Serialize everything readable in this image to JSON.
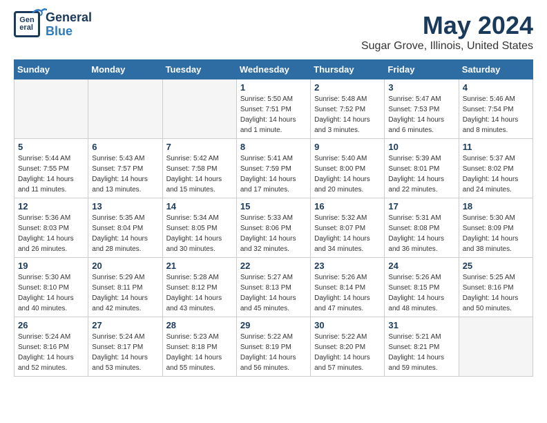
{
  "header": {
    "logo_line1": "General",
    "logo_line2": "Blue",
    "title": "May 2024",
    "subtitle": "Sugar Grove, Illinois, United States"
  },
  "days_of_week": [
    "Sunday",
    "Monday",
    "Tuesday",
    "Wednesday",
    "Thursday",
    "Friday",
    "Saturday"
  ],
  "weeks": [
    [
      {
        "day": "",
        "info": ""
      },
      {
        "day": "",
        "info": ""
      },
      {
        "day": "",
        "info": ""
      },
      {
        "day": "1",
        "info": "Sunrise: 5:50 AM\nSunset: 7:51 PM\nDaylight: 14 hours\nand 1 minute."
      },
      {
        "day": "2",
        "info": "Sunrise: 5:48 AM\nSunset: 7:52 PM\nDaylight: 14 hours\nand 3 minutes."
      },
      {
        "day": "3",
        "info": "Sunrise: 5:47 AM\nSunset: 7:53 PM\nDaylight: 14 hours\nand 6 minutes."
      },
      {
        "day": "4",
        "info": "Sunrise: 5:46 AM\nSunset: 7:54 PM\nDaylight: 14 hours\nand 8 minutes."
      }
    ],
    [
      {
        "day": "5",
        "info": "Sunrise: 5:44 AM\nSunset: 7:55 PM\nDaylight: 14 hours\nand 11 minutes."
      },
      {
        "day": "6",
        "info": "Sunrise: 5:43 AM\nSunset: 7:57 PM\nDaylight: 14 hours\nand 13 minutes."
      },
      {
        "day": "7",
        "info": "Sunrise: 5:42 AM\nSunset: 7:58 PM\nDaylight: 14 hours\nand 15 minutes."
      },
      {
        "day": "8",
        "info": "Sunrise: 5:41 AM\nSunset: 7:59 PM\nDaylight: 14 hours\nand 17 minutes."
      },
      {
        "day": "9",
        "info": "Sunrise: 5:40 AM\nSunset: 8:00 PM\nDaylight: 14 hours\nand 20 minutes."
      },
      {
        "day": "10",
        "info": "Sunrise: 5:39 AM\nSunset: 8:01 PM\nDaylight: 14 hours\nand 22 minutes."
      },
      {
        "day": "11",
        "info": "Sunrise: 5:37 AM\nSunset: 8:02 PM\nDaylight: 14 hours\nand 24 minutes."
      }
    ],
    [
      {
        "day": "12",
        "info": "Sunrise: 5:36 AM\nSunset: 8:03 PM\nDaylight: 14 hours\nand 26 minutes."
      },
      {
        "day": "13",
        "info": "Sunrise: 5:35 AM\nSunset: 8:04 PM\nDaylight: 14 hours\nand 28 minutes."
      },
      {
        "day": "14",
        "info": "Sunrise: 5:34 AM\nSunset: 8:05 PM\nDaylight: 14 hours\nand 30 minutes."
      },
      {
        "day": "15",
        "info": "Sunrise: 5:33 AM\nSunset: 8:06 PM\nDaylight: 14 hours\nand 32 minutes."
      },
      {
        "day": "16",
        "info": "Sunrise: 5:32 AM\nSunset: 8:07 PM\nDaylight: 14 hours\nand 34 minutes."
      },
      {
        "day": "17",
        "info": "Sunrise: 5:31 AM\nSunset: 8:08 PM\nDaylight: 14 hours\nand 36 minutes."
      },
      {
        "day": "18",
        "info": "Sunrise: 5:30 AM\nSunset: 8:09 PM\nDaylight: 14 hours\nand 38 minutes."
      }
    ],
    [
      {
        "day": "19",
        "info": "Sunrise: 5:30 AM\nSunset: 8:10 PM\nDaylight: 14 hours\nand 40 minutes."
      },
      {
        "day": "20",
        "info": "Sunrise: 5:29 AM\nSunset: 8:11 PM\nDaylight: 14 hours\nand 42 minutes."
      },
      {
        "day": "21",
        "info": "Sunrise: 5:28 AM\nSunset: 8:12 PM\nDaylight: 14 hours\nand 43 minutes."
      },
      {
        "day": "22",
        "info": "Sunrise: 5:27 AM\nSunset: 8:13 PM\nDaylight: 14 hours\nand 45 minutes."
      },
      {
        "day": "23",
        "info": "Sunrise: 5:26 AM\nSunset: 8:14 PM\nDaylight: 14 hours\nand 47 minutes."
      },
      {
        "day": "24",
        "info": "Sunrise: 5:26 AM\nSunset: 8:15 PM\nDaylight: 14 hours\nand 48 minutes."
      },
      {
        "day": "25",
        "info": "Sunrise: 5:25 AM\nSunset: 8:16 PM\nDaylight: 14 hours\nand 50 minutes."
      }
    ],
    [
      {
        "day": "26",
        "info": "Sunrise: 5:24 AM\nSunset: 8:16 PM\nDaylight: 14 hours\nand 52 minutes."
      },
      {
        "day": "27",
        "info": "Sunrise: 5:24 AM\nSunset: 8:17 PM\nDaylight: 14 hours\nand 53 minutes."
      },
      {
        "day": "28",
        "info": "Sunrise: 5:23 AM\nSunset: 8:18 PM\nDaylight: 14 hours\nand 55 minutes."
      },
      {
        "day": "29",
        "info": "Sunrise: 5:22 AM\nSunset: 8:19 PM\nDaylight: 14 hours\nand 56 minutes."
      },
      {
        "day": "30",
        "info": "Sunrise: 5:22 AM\nSunset: 8:20 PM\nDaylight: 14 hours\nand 57 minutes."
      },
      {
        "day": "31",
        "info": "Sunrise: 5:21 AM\nSunset: 8:21 PM\nDaylight: 14 hours\nand 59 minutes."
      },
      {
        "day": "",
        "info": ""
      }
    ]
  ]
}
